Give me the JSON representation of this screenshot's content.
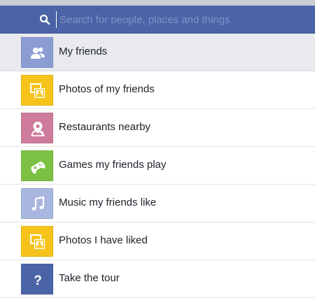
{
  "search": {
    "placeholder": "Search for people, places and things",
    "value": ""
  },
  "suggestions": [
    {
      "label": "My friends",
      "icon": "friends-icon",
      "color": "#8b9dd3",
      "selected": true
    },
    {
      "label": "Photos of my friends",
      "icon": "photo-icon",
      "color": "#f6c31b",
      "selected": false
    },
    {
      "label": "Restaurants nearby",
      "icon": "map-pin-icon",
      "color": "#cf7b9b",
      "selected": false
    },
    {
      "label": "Games my friends play",
      "icon": "gamepad-icon",
      "color": "#7cc144",
      "selected": false
    },
    {
      "label": "Music my friends like",
      "icon": "music-note-icon",
      "color": "#a9b6df",
      "selected": false
    },
    {
      "label": "Photos I have liked",
      "icon": "photo-icon",
      "color": "#f6c31b",
      "selected": false
    },
    {
      "label": "Take the tour",
      "icon": "question-icon",
      "color": "#4b64a7",
      "selected": false
    }
  ],
  "colors": {
    "header": "#4b64a7",
    "selected_row": "#e9eaed"
  }
}
